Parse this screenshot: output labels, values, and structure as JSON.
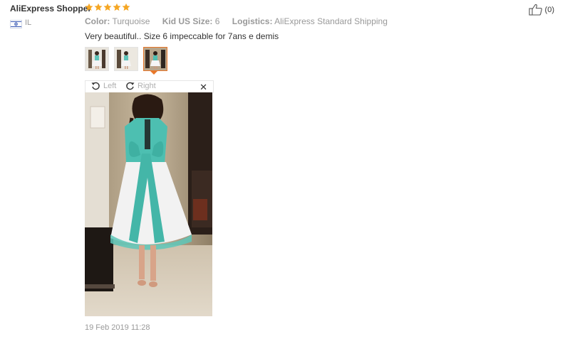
{
  "reviewer": {
    "name": "AliExpress Shopper",
    "country": "IL",
    "rating": 5
  },
  "meta": {
    "color_label": "Color:",
    "color_value": "Turquoise",
    "size_label": "Kid US Size:",
    "size_value": "6",
    "logistics_label": "Logistics:",
    "logistics_value": "AliExpress Standard Shipping"
  },
  "review_text": "Very beautiful.. Size 6 impeccable for 7ans e demis",
  "helpful": {
    "count": "(0)"
  },
  "viewer": {
    "rotate_left": "Left",
    "rotate_right": "Right"
  },
  "date": "19 Feb 2019 11:28",
  "colors": {
    "star": "#f5a623",
    "accent": "#e8772a"
  }
}
